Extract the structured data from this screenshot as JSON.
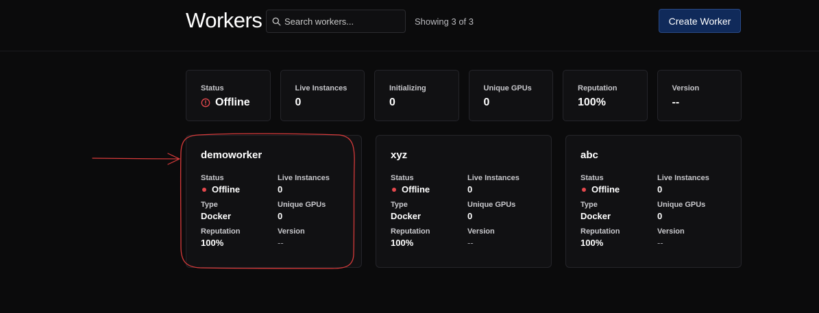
{
  "header": {
    "title": "Workers",
    "search_placeholder": "Search workers...",
    "showing": "Showing 3 of 3",
    "create_button": "Create Worker"
  },
  "summary": [
    {
      "label": "Status",
      "value": "Offline",
      "icon": "alert-circle-icon",
      "color": "#e5484d"
    },
    {
      "label": "Live Instances",
      "value": "0"
    },
    {
      "label": "Initializing",
      "value": "0"
    },
    {
      "label": "Unique GPUs",
      "value": "0"
    },
    {
      "label": "Reputation",
      "value": "100%"
    },
    {
      "label": "Version",
      "value": "--"
    }
  ],
  "workers": [
    {
      "name": "demoworker",
      "status_label": "Status",
      "status": "Offline",
      "live_label": "Live Instances",
      "live": "0",
      "type_label": "Type",
      "type": "Docker",
      "gpus_label": "Unique GPUs",
      "gpus": "0",
      "reputation_label": "Reputation",
      "reputation": "100%",
      "version_label": "Version",
      "version": "--"
    },
    {
      "name": "xyz",
      "status_label": "Status",
      "status": "Offline",
      "live_label": "Live Instances",
      "live": "0",
      "type_label": "Type",
      "type": "Docker",
      "gpus_label": "Unique GPUs",
      "gpus": "0",
      "reputation_label": "Reputation",
      "reputation": "100%",
      "version_label": "Version",
      "version": "--"
    },
    {
      "name": "abc",
      "status_label": "Status",
      "status": "Offline",
      "live_label": "Live Instances",
      "live": "0",
      "type_label": "Type",
      "type": "Docker",
      "gpus_label": "Unique GPUs",
      "gpus": "0",
      "reputation_label": "Reputation",
      "reputation": "100%",
      "version_label": "Version",
      "version": "--"
    }
  ],
  "colors": {
    "background": "#0b0b0c",
    "accent_button": "#102a5a",
    "offline": "#e5484d",
    "annotation": "#d93b3b"
  }
}
